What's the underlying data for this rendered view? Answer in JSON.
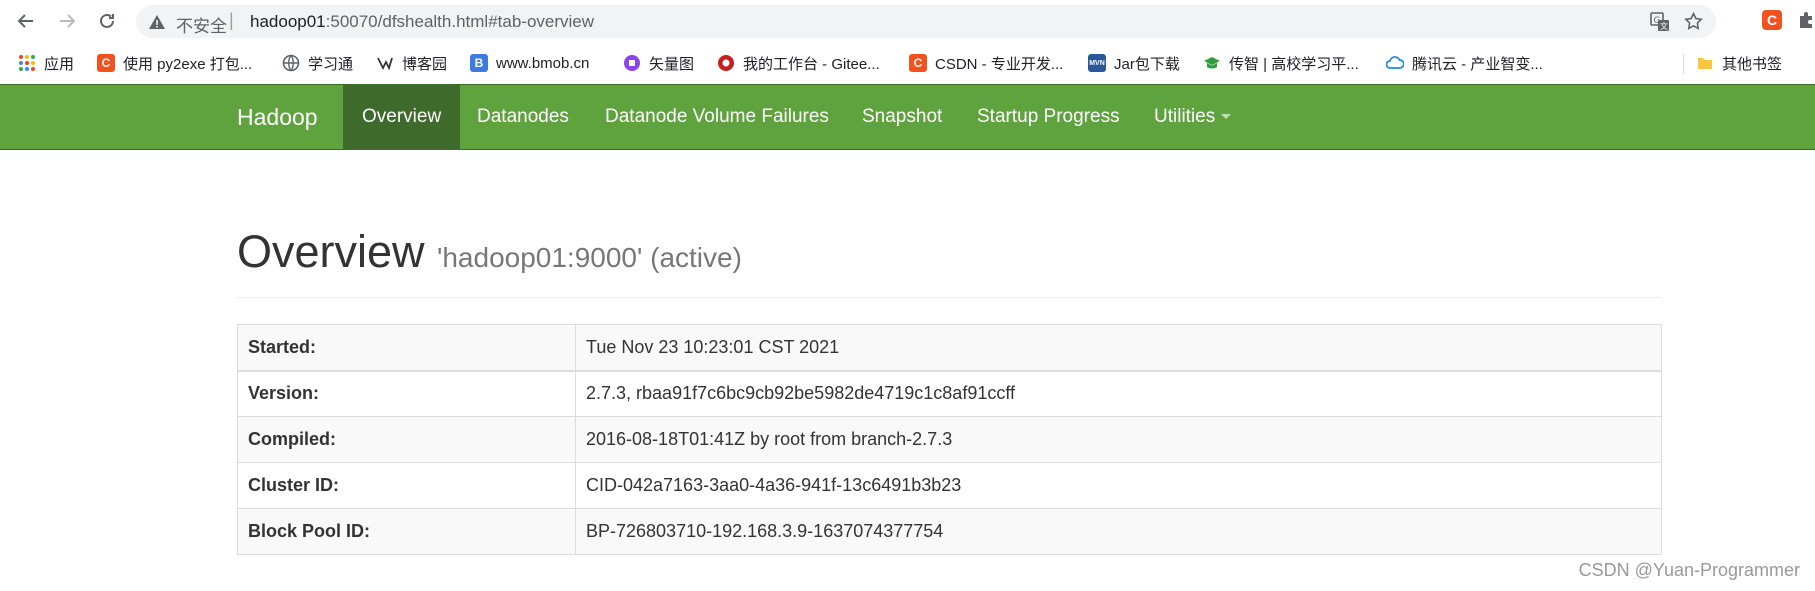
{
  "browser": {
    "insecure_label": "不安全",
    "separator": "|",
    "url_host": "hadoop01",
    "url_path": ":50070/dfshealth.html#tab-overview",
    "ext_letter": "C",
    "bookmarks": [
      {
        "label": "应用",
        "icon": "apps-grid-icon"
      },
      {
        "label": "使用 py2exe 打包...",
        "icon": "csdn-c-icon",
        "letter": "C"
      },
      {
        "label": "学习通",
        "icon": "globe-icon"
      },
      {
        "label": "博客园",
        "icon": "cnblogs-icon"
      },
      {
        "label": "www.bmob.cn",
        "icon": "bmob-b-icon",
        "letter": "B"
      },
      {
        "label": "矢量图",
        "icon": "iconfont-icon"
      },
      {
        "label": "我的工作台 - Gitee...",
        "icon": "gitee-icon"
      },
      {
        "label": "CSDN - 专业开发...",
        "icon": "csdn-c-icon",
        "letter": "C"
      },
      {
        "label": "Jar包下载",
        "icon": "mvn-icon",
        "letter": "MVN"
      },
      {
        "label": "传智 | 高校学习平...",
        "icon": "graduation-cap-icon"
      },
      {
        "label": "腾讯云 - 产业智变...",
        "icon": "cloud-icon"
      },
      {
        "label": "其他书签",
        "icon": "folder-icon"
      }
    ],
    "colors": {
      "csdn": "#f4511e",
      "bmob": "#3d7be0",
      "mvn": "#2b5797",
      "hadoop_green": "#5fa33e"
    }
  },
  "navbar": {
    "brand": "Hadoop",
    "items": [
      {
        "label": "Overview",
        "active": true
      },
      {
        "label": "Datanodes"
      },
      {
        "label": "Datanode Volume Failures"
      },
      {
        "label": "Snapshot"
      },
      {
        "label": "Startup Progress"
      },
      {
        "label": "Utilities"
      }
    ]
  },
  "page": {
    "title": "Overview",
    "subtitle": "'hadoop01:9000' (active)"
  },
  "overview_table": [
    {
      "key": "Started:",
      "value": "Tue Nov 23 10:23:01 CST 2021"
    },
    {
      "key": "Version:",
      "value": "2.7.3, rbaa91f7c6bc9cb92be5982de4719c1c8af91ccff"
    },
    {
      "key": "Compiled:",
      "value": "2016-08-18T01:41Z by root from branch-2.7.3"
    },
    {
      "key": "Cluster ID:",
      "value": "CID-042a7163-3aa0-4a36-941f-13c6491b3b23"
    },
    {
      "key": "Block Pool ID:",
      "value": "BP-726803710-192.168.3.9-1637074377754"
    }
  ],
  "watermark": "CSDN @Yuan-Programmer"
}
